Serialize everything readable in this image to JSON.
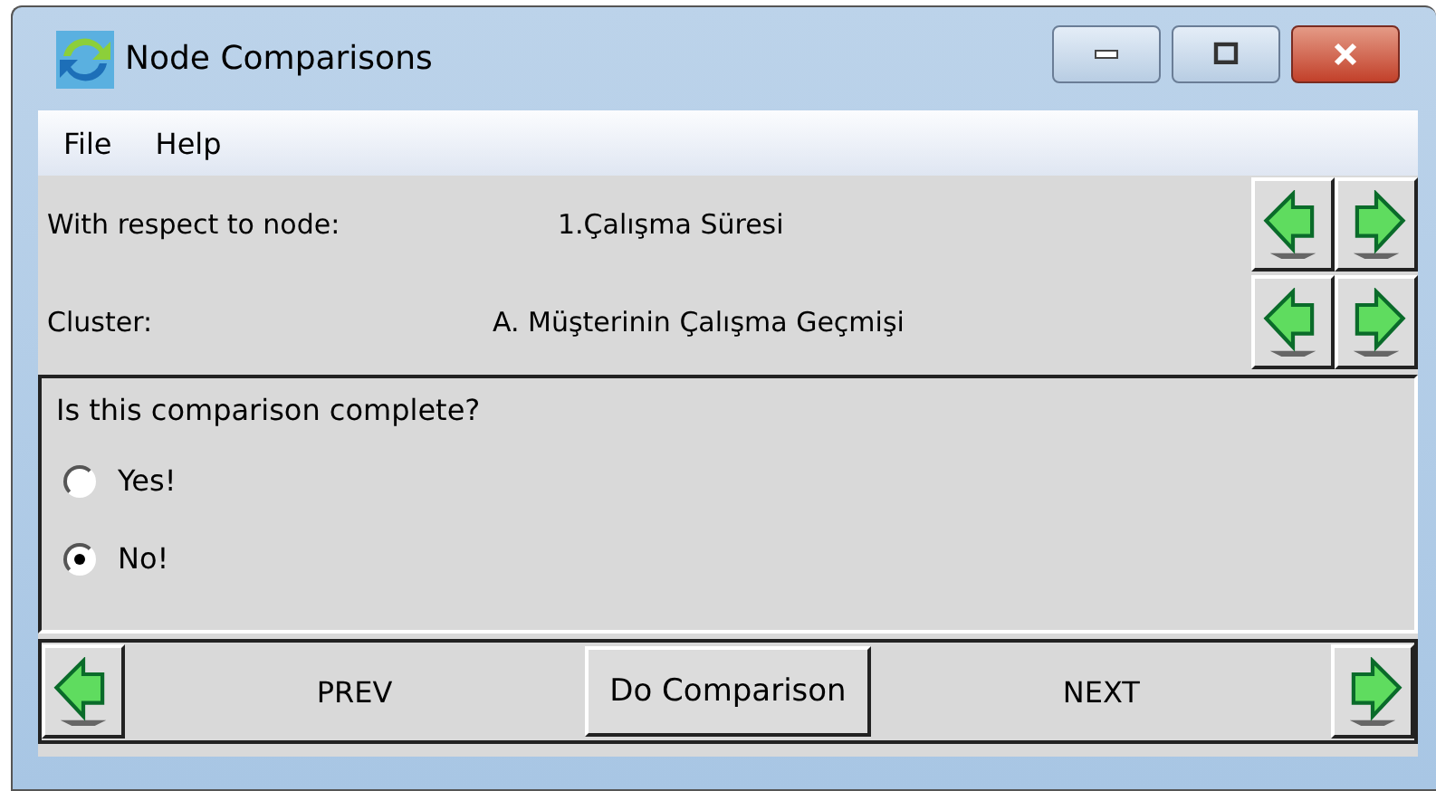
{
  "window": {
    "title": "Node Comparisons"
  },
  "menu": [
    "File",
    "Help"
  ],
  "rows": [
    {
      "label": "With respect to node:",
      "value": "1.Çalışma Süresi"
    },
    {
      "label": "Cluster:",
      "value": "A. Müşterinin Çalışma Geçmişi"
    }
  ],
  "question": {
    "text": "Is this comparison complete?",
    "options": [
      {
        "label": "Yes!",
        "selected": false
      },
      {
        "label": "No!",
        "selected": true
      }
    ]
  },
  "footer": {
    "prev": "PREV",
    "action": "Do Comparison",
    "next": "NEXT"
  }
}
